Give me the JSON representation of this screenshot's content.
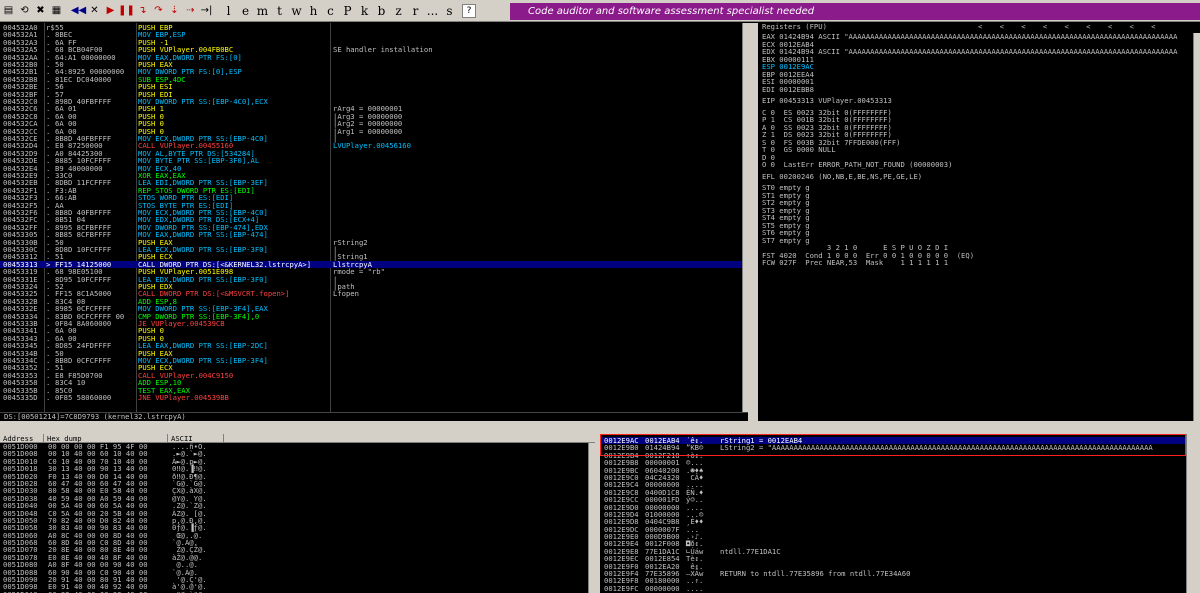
{
  "toolbar": {
    "letters": [
      "l",
      "e",
      "m",
      "t",
      "w",
      "h",
      "c",
      "P",
      "k",
      "b",
      "z",
      "r",
      "...",
      "s"
    ],
    "help": "?",
    "banner": "Code auditor and software assessment specialist needed"
  },
  "cpu": {
    "rows": [
      {
        "a": "004532A0",
        "m": "r$",
        "h": "55",
        "i": "PUSH EBP",
        "k": "push",
        "c": ""
      },
      {
        "a": "004532A1",
        "m": ".",
        "h": "8BEC",
        "i": "MOV EBP,ESP",
        "k": "mov",
        "c": ""
      },
      {
        "a": "004532A3",
        "m": ".",
        "h": "6A FF",
        "i": "PUSH -1",
        "k": "push",
        "c": ""
      },
      {
        "a": "004532A5",
        "m": ".",
        "h": "68 BCB04F00",
        "i": "PUSH VUPlayer.004FB0BC",
        "k": "push",
        "c": "SE handler installation"
      },
      {
        "a": "004532AA",
        "m": ".",
        "h": "64:A1 00000000",
        "i": "MOV EAX,DWORD PTR FS:[0]",
        "k": "mov",
        "c": ""
      },
      {
        "a": "004532B0",
        "m": ".",
        "h": "50",
        "i": "PUSH EAX",
        "k": "push",
        "c": ""
      },
      {
        "a": "004532B1",
        "m": ".",
        "h": "64:8925 00000000",
        "i": "MOV DWORD PTR FS:[0],ESP",
        "k": "mov",
        "c": ""
      },
      {
        "a": "004532B8",
        "m": ".",
        "h": "81EC DC040000",
        "i": "SUB ESP,4DC",
        "k": "arith",
        "c": ""
      },
      {
        "a": "004532BE",
        "m": ".",
        "h": "56",
        "i": "PUSH ESI",
        "k": "push",
        "c": ""
      },
      {
        "a": "004532BF",
        "m": ".",
        "h": "57",
        "i": "PUSH EDI",
        "k": "push",
        "c": ""
      },
      {
        "a": "004532C0",
        "m": ".",
        "h": "898D 40FBFFFF",
        "i": "MOV DWORD PTR SS:[EBP-4C0],ECX",
        "k": "mov",
        "c": ""
      },
      {
        "a": "004532C6",
        "m": ".",
        "h": "6A 01",
        "i": "PUSH 1",
        "k": "push",
        "c": "rArg4 = 00000001"
      },
      {
        "a": "004532C8",
        "m": ".",
        "h": "6A 00",
        "i": "PUSH 0",
        "k": "push",
        "c": "|Arg3 = 00000000"
      },
      {
        "a": "004532CA",
        "m": ".",
        "h": "6A 00",
        "i": "PUSH 0",
        "k": "push",
        "c": "|Arg2 = 00000000"
      },
      {
        "a": "004532CC",
        "m": ".",
        "h": "6A 00",
        "i": "PUSH 0",
        "k": "push",
        "c": "|Arg1 = 00000000"
      },
      {
        "a": "004532CE",
        "m": ".",
        "h": "8B8D 40FBFFFF",
        "i": "MOV ECX,DWORD PTR SS:[EBP-4C0]",
        "k": "mov",
        "c": "|"
      },
      {
        "a": "004532D4",
        "m": ".",
        "h": "E8 87250000",
        "i": "CALL VUPlayer.00455160",
        "k": "call",
        "c": "LVUPlayer.00456160"
      },
      {
        "a": "004532D9",
        "m": ".",
        "h": "A0 84425300",
        "i": "MOV AL,BYTE PTR DS:[534284]",
        "k": "mov",
        "c": ""
      },
      {
        "a": "004532DE",
        "m": ".",
        "h": "8885 10FCFFFF",
        "i": "MOV BYTE PTR SS:[EBP-3F0],AL",
        "k": "mov",
        "c": ""
      },
      {
        "a": "004532E4",
        "m": ".",
        "h": "B9 40000000",
        "i": "MOV ECX,40",
        "k": "mov",
        "c": ""
      },
      {
        "a": "004532E9",
        "m": ".",
        "h": "33C0",
        "i": "XOR EAX,EAX",
        "k": "arith",
        "c": ""
      },
      {
        "a": "004532EB",
        "m": ".",
        "h": "8DBD 11FCFFFF",
        "i": "LEA EDI,DWORD PTR SS:[EBP-3EF]",
        "k": "lea",
        "c": ""
      },
      {
        "a": "004532F1",
        "m": ".",
        "h": "F3:AB",
        "i": "REP STOS DWORD PTR ES:[EDI]",
        "k": "rep",
        "c": ""
      },
      {
        "a": "004532F3",
        "m": ".",
        "h": "66:AB",
        "i": "STOS WORD PTR ES:[EDI]",
        "k": "stos",
        "c": ""
      },
      {
        "a": "004532F5",
        "m": ".",
        "h": "AA",
        "i": "STOS BYTE PTR ES:[EDI]",
        "k": "stos",
        "c": ""
      },
      {
        "a": "004532F6",
        "m": ".",
        "h": "8B8D 40FBFFFF",
        "i": "MOV ECX,DWORD PTR SS:[EBP-4C0]",
        "k": "mov",
        "c": ""
      },
      {
        "a": "004532FC",
        "m": ".",
        "h": "8B51 04",
        "i": "MOV EDX,DWORD PTR DS:[ECX+4]",
        "k": "mov",
        "c": ""
      },
      {
        "a": "004532FF",
        "m": ".",
        "h": "8995 8CFBFFFF",
        "i": "MOV DWORD PTR SS:[EBP-474],EDX",
        "k": "mov",
        "c": ""
      },
      {
        "a": "00453305",
        "m": ".",
        "h": "8B85 8CFBFFFF",
        "i": "MOV EAX,DWORD PTR SS:[EBP-474]",
        "k": "mov",
        "c": ""
      },
      {
        "a": "0045330B",
        "m": ".",
        "h": "50",
        "i": "PUSH EAX",
        "k": "push",
        "c": "rString2"
      },
      {
        "a": "0045330C",
        "m": ".",
        "h": "8D8D 10FCFFFF",
        "i": "LEA ECX,DWORD PTR SS:[EBP-3F0]",
        "k": "lea",
        "c": "|"
      },
      {
        "a": "00453312",
        "m": ".",
        "h": "51",
        "i": "PUSH ECX",
        "k": "push",
        "c": "|String1"
      },
      {
        "a": "00453313",
        "m": ">",
        "h": "FF15 14125000",
        "i": "CALL DWORD PTR DS:[<&KERNEL32.lstrcpyA>]",
        "k": "call",
        "c": "LlstrcpyA",
        "sel": true
      },
      {
        "a": "00453319",
        "m": ".",
        "h": "68 98E05100",
        "i": "PUSH VUPlayer.0051E098",
        "k": "push",
        "c": "rmode = \"rb\""
      },
      {
        "a": "0045331E",
        "m": ".",
        "h": "8D95 10FCFFFF",
        "i": "LEA EDX,DWORD PTR SS:[EBP-3F0]",
        "k": "lea",
        "c": "|"
      },
      {
        "a": "00453324",
        "m": ".",
        "h": "52",
        "i": "PUSH EDX",
        "k": "push",
        "c": "|path"
      },
      {
        "a": "00453325",
        "m": ".",
        "h": "FF15 8C1A5000",
        "i": "CALL DWORD PTR DS:[<&MSVCRT.fopen>]",
        "k": "call",
        "c": "Lfopen"
      },
      {
        "a": "0045332B",
        "m": ".",
        "h": "83C4 08",
        "i": "ADD ESP,8",
        "k": "arith",
        "c": ""
      },
      {
        "a": "0045332E",
        "m": ".",
        "h": "8985 0CFCFFFF",
        "i": "MOV DWORD PTR SS:[EBP-3F4],EAX",
        "k": "mov",
        "c": ""
      },
      {
        "a": "00453334",
        "m": ".",
        "h": "83BD 0CFCFFFF 00",
        "i": "CMP DWORD PTR SS:[EBP-3F4],0",
        "k": "arith",
        "c": ""
      },
      {
        "a": "0045333B",
        "m": ".",
        "h": "0F84 8A060000",
        "i": "JE VUPlayer.004539CB",
        "k": "jmp",
        "c": ""
      },
      {
        "a": "00453341",
        "m": ".",
        "h": "6A 00",
        "i": "PUSH 0",
        "k": "push",
        "c": ""
      },
      {
        "a": "00453343",
        "m": ".",
        "h": "6A 00",
        "i": "PUSH 0",
        "k": "push",
        "c": ""
      },
      {
        "a": "00453345",
        "m": ".",
        "h": "8D85 24FDFFFF",
        "i": "LEA EAX,DWORD PTR SS:[EBP-2DC]",
        "k": "lea",
        "c": ""
      },
      {
        "a": "0045334B",
        "m": ".",
        "h": "50",
        "i": "PUSH EAX",
        "k": "push",
        "c": ""
      },
      {
        "a": "0045334C",
        "m": ".",
        "h": "8B8D 0CFCFFFF",
        "i": "MOV ECX,DWORD PTR SS:[EBP-3F4]",
        "k": "mov",
        "c": ""
      },
      {
        "a": "00453352",
        "m": ".",
        "h": "51",
        "i": "PUSH ECX",
        "k": "push",
        "c": ""
      },
      {
        "a": "00453353",
        "m": ".",
        "h": "E8 F85D0700",
        "i": "CALL VUPlayer.004C9150",
        "k": "call",
        "c": ""
      },
      {
        "a": "00453358",
        "m": ".",
        "h": "83C4 10",
        "i": "ADD ESP,10",
        "k": "arith",
        "c": ""
      },
      {
        "a": "0045335B",
        "m": ".",
        "h": "85C0",
        "i": "TEST EAX,EAX",
        "k": "test",
        "c": ""
      },
      {
        "a": "0045335D",
        "m": ".",
        "h": "0F85 58060000",
        "i": "JNE VUPlayer.004539BB",
        "k": "jmp",
        "c": ""
      }
    ],
    "status": "DS:[00501214]=7C8D9793 (kernel32.lstrcpyA)"
  },
  "registers": {
    "title": "Registers (FPU)",
    "lines": [
      {
        "t": "EAX 01424B94 ASCII \"AAAAAAAAAAAAAAAAAAAAAAAAAAAAAAAAAAAAAAAAAAAAAAAAAAAAAAAAAAAAAAAAAAAAAAAAAAAA"
      },
      {
        "t": "ECX 0012EAB4"
      },
      {
        "t": "EDX 01424B94 ASCII \"AAAAAAAAAAAAAAAAAAAAAAAAAAAAAAAAAAAAAAAAAAAAAAAAAAAAAAAAAAAAAAAAAAAAAAAAAAAA"
      },
      {
        "t": "EBX 00000111"
      },
      {
        "t": "ESP 0012E9AC",
        "hl": true
      },
      {
        "t": "EBP 0012EEA4"
      },
      {
        "t": "ESI 00000001"
      },
      {
        "t": "EDI 0012EBB8"
      },
      {
        "t": "",
        "gap": true
      },
      {
        "t": "EIP 00453313 VUPlayer.00453313"
      },
      {
        "t": "",
        "gap": true
      },
      {
        "t": "C 0  ES 0023 32bit 0(FFFFFFFF)"
      },
      {
        "t": "P 1  CS 001B 32bit 0(FFFFFFFF)"
      },
      {
        "t": "A 0  SS 0023 32bit 0(FFFFFFFF)"
      },
      {
        "t": "Z 1  DS 0023 32bit 0(FFFFFFFF)"
      },
      {
        "t": "S 0  FS 003B 32bit 7FFDE000(FFF)"
      },
      {
        "t": "T 0  GS 0000 NULL"
      },
      {
        "t": "D 0"
      },
      {
        "t": "O 0  LastErr ERROR_PATH_NOT_FOUND (00000003)"
      },
      {
        "t": "",
        "gap": true
      },
      {
        "t": "EFL 00200246 (NO,NB,E,BE,NS,PE,GE,LE)"
      },
      {
        "t": "",
        "gap": true
      },
      {
        "t": "ST0 empty g"
      },
      {
        "t": "ST1 empty g"
      },
      {
        "t": "ST2 empty g"
      },
      {
        "t": "ST3 empty g"
      },
      {
        "t": "ST4 empty g"
      },
      {
        "t": "ST5 empty g"
      },
      {
        "t": "ST6 empty g"
      },
      {
        "t": "ST7 empty g"
      },
      {
        "t": "               3 2 1 0      E S P U O Z D I"
      },
      {
        "t": "FST 4020  Cond 1 0 0 0  Err 0 0 1 0 0 0 0 0  (EQ)"
      },
      {
        "t": "FCW 027F  Prec NEAR,53  Mask    1 1 1 1 1 1"
      }
    ]
  },
  "dump": {
    "head_address": "Address",
    "head_hex": "Hex dump",
    "head_ascii": "ASCII",
    "rows": [
      {
        "a": "0051D000",
        "h": "00 00 00 00 F1 95 4F 00",
        "s": "....ñ•O."
      },
      {
        "a": "0051D008",
        "h": "00 10 40 00 60 10 40 00",
        "s": ".►@.`►@."
      },
      {
        "a": "0051D010",
        "h": "C0 10 40 00 70 10 40 00",
        "s": "À►@.p►@."
      },
      {
        "a": "0051D018",
        "h": "30 13 40 00 90 13 40 00",
        "s": "0‼@.▐‼@."
      },
      {
        "a": "0051D020",
        "h": "F0 13 40 00 D0 14 40 00",
        "s": "ð‼@.Đ¶@."
      },
      {
        "a": "0051D028",
        "h": "60 47 40 00 60 47 40 00",
        "s": "`G@.`G@."
      },
      {
        "a": "0051D030",
        "h": "80 58 40 00 E0 58 40 00",
        "s": "ÇX@.àX@."
      },
      {
        "a": "0051D038",
        "h": "40 59 40 00 A0 59 40 00",
        "s": "@Y@. Y@."
      },
      {
        "a": "0051D040",
        "h": "00 5A 40 00 60 5A 40 00",
        "s": ".Z@.`Z@."
      },
      {
        "a": "0051D048",
        "h": "C0 5A 40 00 20 5B 40 00",
        "s": "ÀZ@. [@."
      },
      {
        "a": "0051D050",
        "h": "70 82 40 00 D0 82 40 00",
        "s": "p‚@.Ð‚@."
      },
      {
        "a": "0051D058",
        "h": "30 83 40 00 90 83 40 00",
        "s": "0ƒ@.▐ƒ@."
      },
      {
        "a": "0051D060",
        "h": "A0 8C 40 00 00 8D 40 00",
        "s": " Œ@..@."
      },
      {
        "a": "0051D068",
        "h": "60 8D 40 00 C0 8D 40 00",
        "s": "`@.À@."
      },
      {
        "a": "0051D070",
        "h": "20 8E 40 00 80 8E 40 00",
        "s": " Ž@.ÇŽ@."
      },
      {
        "a": "0051D078",
        "h": "E0 8E 40 00 40 8F 40 00",
        "s": "àŽ@.@@."
      },
      {
        "a": "0051D080",
        "h": "A0 8F 40 00 00 90 40 00",
        "s": " @..@."
      },
      {
        "a": "0051D088",
        "h": "60 90 40 00 C0 90 40 00",
        "s": "`@.À@."
      },
      {
        "a": "0051D090",
        "h": "20 91 40 00 80 91 40 00",
        "s": " '@.Ç'@."
      },
      {
        "a": "0051D098",
        "h": "E0 91 40 00 40 92 40 00",
        "s": "à'@.@'@."
      },
      {
        "a": "0051D0A0",
        "h": "00 93 40 00 60 93 40 00",
        "s": ".\"@.`\"@."
      }
    ]
  },
  "stack": {
    "rows": [
      {
        "a": "0012E9AC",
        "v": "0012EAB4",
        "s": "´ê↕.",
        "c": "rString1 = 0012EAB4",
        "sel": true
      },
      {
        "a": "0012E9B0",
        "v": "01424B94",
        "s": "”KB☺",
        "c": "LString2 = \"AAAAAAAAAAAAAAAAAAAAAAAAAAAAAAAAAAAAAAAAAAAAAAAAAAAAAAAAAAAAAAAAAAAAAAAAAAAAAAAAAAAAAAAA"
      },
      {
        "a": "0012E9B4",
        "v": "0012F218",
        "s": "↑ò↕.",
        "c": ""
      },
      {
        "a": "0012E9B8",
        "v": "00000001",
        "s": "☺...",
        "c": ""
      },
      {
        "a": "0012E9BC",
        "v": "06040200",
        "s": ".☻♦♠",
        "c": ""
      },
      {
        "a": "0012E9C0",
        "v": "04C24320",
        "s": " CÂ♦",
        "c": ""
      },
      {
        "a": "0012E9C4",
        "v": "00000000",
        "s": "....",
        "c": ""
      },
      {
        "a": "0012E9C8",
        "v": "0400D1C8",
        "s": "ÈÑ.♦",
        "c": ""
      },
      {
        "a": "0012E9CC",
        "v": "000001FD",
        "s": "ý☺..",
        "c": ""
      },
      {
        "a": "0012E9D0",
        "v": "00000000",
        "s": "....",
        "c": ""
      },
      {
        "a": "0012E9D4",
        "v": "01000000",
        "s": "...☺",
        "c": ""
      },
      {
        "a": "0012E9D8",
        "v": "0404C9B8",
        "s": "¸É♦♦",
        "c": ""
      },
      {
        "a": "0012E9DC",
        "v": "0000007F",
        "s": "...",
        "c": ""
      },
      {
        "a": "0012E9E0",
        "v": "000D9B00",
        "s": ".›♪.",
        "c": ""
      },
      {
        "a": "0012E9E4",
        "v": "0012F008",
        "s": "◘ð↕.",
        "c": ""
      },
      {
        "a": "0012E9E8",
        "v": "77E1DA1C",
        "s": "∟Úáw",
        "c": "ntdll.77E1DA1C"
      },
      {
        "a": "0012E9EC",
        "v": "0012E854",
        "s": "Tè↕.",
        "c": ""
      },
      {
        "a": "0012E9F0",
        "v": "0012EA20",
        "s": " ê↕.",
        "c": ""
      },
      {
        "a": "0012E9F4",
        "v": "77E35896",
        "s": "–XÃw",
        "c": "RETURN to ntdll.77E35896 from ntdll.77E34A60"
      },
      {
        "a": "0012E9F8",
        "v": "00180000",
        "s": "..↑.",
        "c": ""
      },
      {
        "a": "0012E9FC",
        "v": "00000000",
        "s": "....",
        "c": ""
      }
    ]
  }
}
